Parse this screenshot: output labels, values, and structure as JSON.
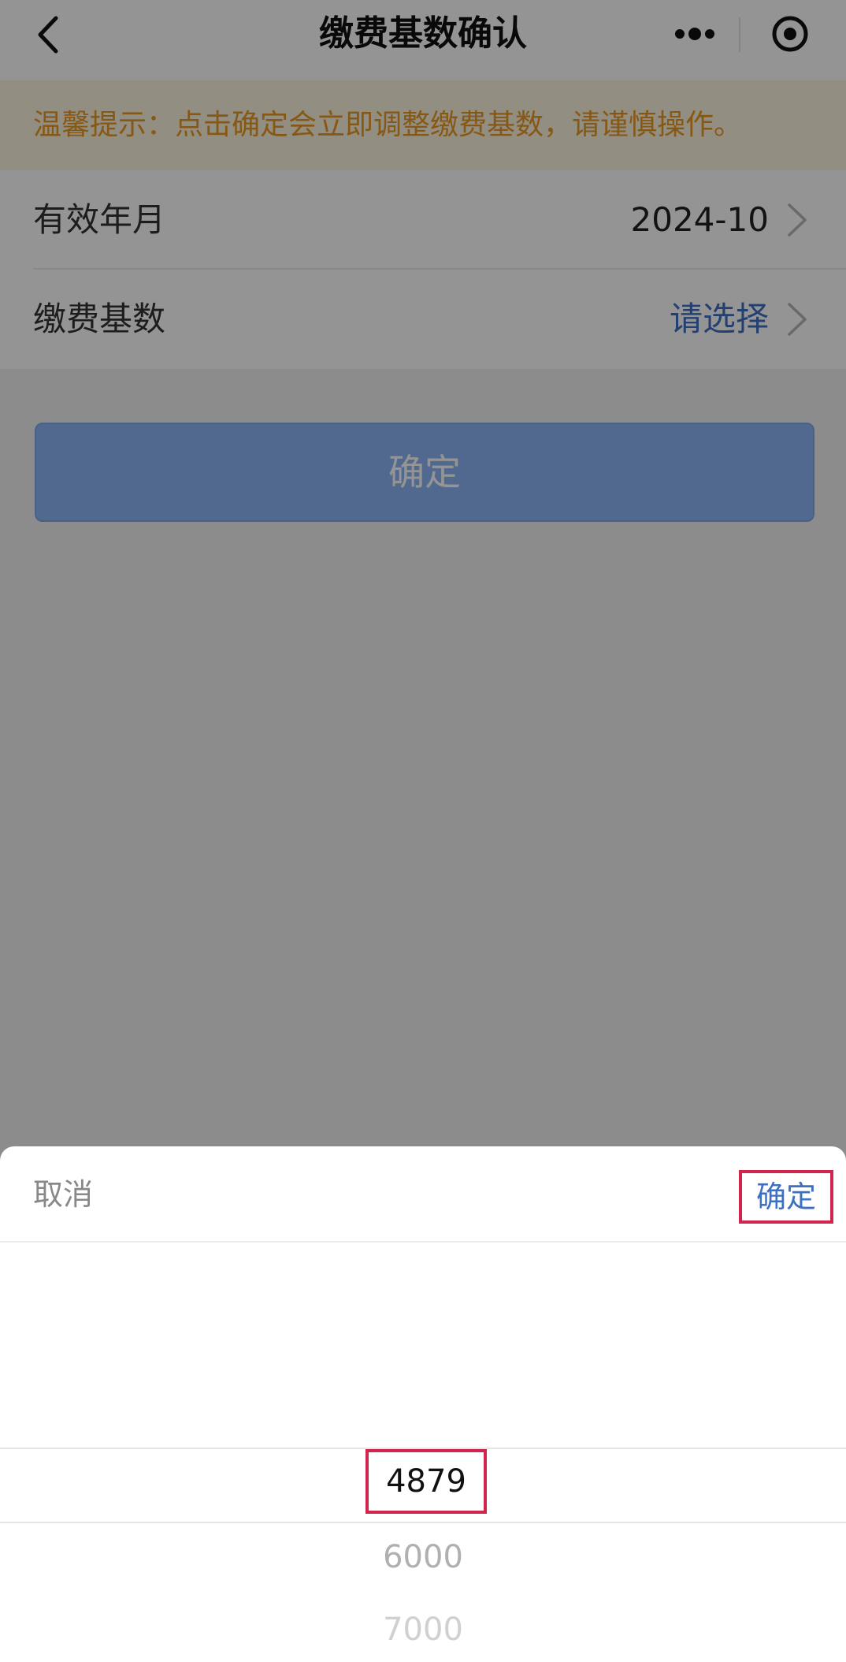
{
  "navbar": {
    "title": "缴费基数确认"
  },
  "notice": {
    "text": "温馨提示：点击确定会立即调整缴费基数，请谨慎操作。"
  },
  "form": {
    "rows": [
      {
        "label": "有效年月",
        "value": "2024-10"
      },
      {
        "label": "缴费基数",
        "value": "请选择"
      }
    ],
    "confirm_label": "确定"
  },
  "picker": {
    "cancel_label": "取消",
    "confirm_label": "确定",
    "options": [
      "4879",
      "6000",
      "7000"
    ],
    "selected": "4879"
  },
  "colors": {
    "notice_bg": "#fcf4e0",
    "notice_text": "#e89723",
    "link_blue": "#3d6fc2",
    "button_blue": "#8cb6f4",
    "highlight_red": "#d2254e"
  },
  "icons": {
    "back": "chevron-left-icon",
    "more": "more-dots-icon",
    "close": "target-circle-icon",
    "row_arrow": "chevron-right-icon"
  }
}
